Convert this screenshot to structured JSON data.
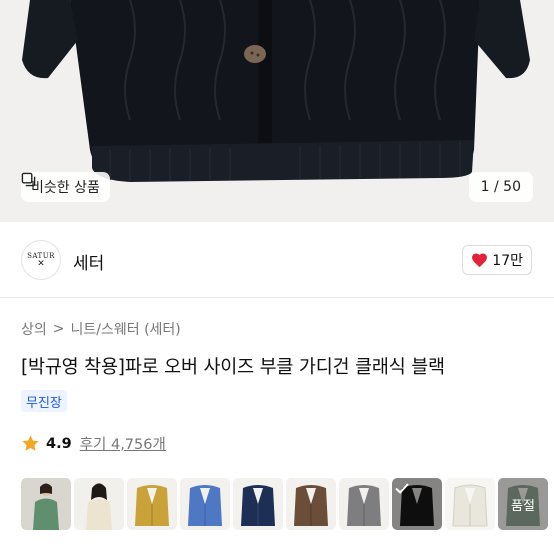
{
  "gallery": {
    "similar_label": "비슷한 상품",
    "similar_icon": "similar-items-icon",
    "counter": "1 / 50"
  },
  "brand": {
    "logo_text": "SATUR",
    "name": "세터",
    "like_count": "17만",
    "like_color": "#e0223a"
  },
  "breadcrumb": {
    "items": [
      "상의",
      "니트/스웨터 (세터)"
    ],
    "separator": ">"
  },
  "product": {
    "title": "[박규영 착용]파로 오버 사이즈 부클 가디건 클래식 블랙",
    "badge": "무진장",
    "badge_color": "#1c5ae5"
  },
  "rating": {
    "score": "4.9",
    "review_label": "후기 4,756개",
    "star_color": "#f5a623"
  },
  "swatches": {
    "items": [
      {
        "name": "model-green",
        "color": "#5f8f6f"
      },
      {
        "name": "model-cream",
        "color": "#ece4cf"
      },
      {
        "name": "mustard",
        "color": "#c9a23a"
      },
      {
        "name": "blue",
        "color": "#4f78c4"
      },
      {
        "name": "navy",
        "color": "#1e2f55"
      },
      {
        "name": "brown",
        "color": "#6b4e3a"
      },
      {
        "name": "gray",
        "color": "#7e7e80"
      },
      {
        "name": "black",
        "color": "#1a1a1a",
        "selected": true
      },
      {
        "name": "ivory",
        "color": "#e9e6dc"
      },
      {
        "name": "soldout-green",
        "color": "#5c7a62",
        "soldout": true
      }
    ],
    "soldout_label": "품절"
  }
}
